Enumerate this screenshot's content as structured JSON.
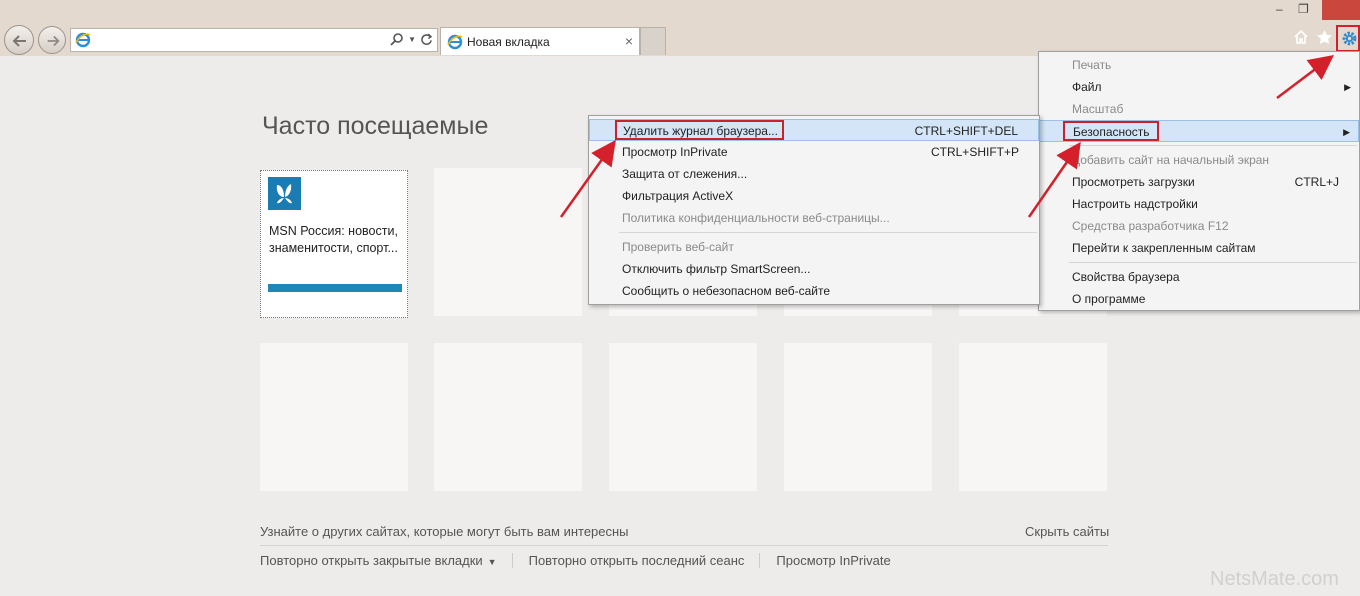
{
  "browser": {
    "tab_title": "Новая вкладка",
    "address_value": ""
  },
  "page": {
    "heading": "Часто посещаемые",
    "tiles": [
      {
        "title": "MSN Россия: новости, знаменитости, спорт..."
      }
    ],
    "suggest_link": "Узнайте о других сайтах, которые могут быть вам интересны",
    "hide_link": "Скрыть сайты",
    "bottom_links": [
      "Повторно открыть закрытые вкладки",
      "Повторно открыть последний сеанс",
      "Просмотр InPrivate"
    ],
    "watermark": "NetsMate.com"
  },
  "tools_menu": {
    "items": [
      {
        "label": "Печать",
        "disabled": true,
        "submenu": true
      },
      {
        "label": "Файл",
        "disabled": false,
        "submenu": true
      },
      {
        "label": "Масштаб",
        "disabled": true,
        "submenu": true
      },
      {
        "label": "Безопасность",
        "disabled": false,
        "submenu": true,
        "highlighted": true
      },
      {
        "label": "Добавить сайт на начальный экран",
        "disabled": true
      },
      {
        "label": "Просмотреть загрузки",
        "shortcut": "CTRL+J"
      },
      {
        "label": "Настроить надстройки"
      },
      {
        "label": "Средства разработчика F12",
        "disabled": true
      },
      {
        "label": "Перейти к закрепленным сайтам"
      },
      {
        "label": "Свойства браузера"
      },
      {
        "label": "О программе"
      }
    ]
  },
  "security_menu": {
    "items": [
      {
        "label": "Удалить журнал браузера...",
        "shortcut": "CTRL+SHIFT+DEL",
        "highlighted": true
      },
      {
        "label": "Просмотр InPrivate",
        "shortcut": "CTRL+SHIFT+P"
      },
      {
        "label": "Защита от слежения..."
      },
      {
        "label": "Фильтрация ActiveX"
      },
      {
        "label": "Политика конфиденциальности веб-страницы...",
        "disabled": true
      },
      {
        "label": "Проверить веб-сайт",
        "disabled": true
      },
      {
        "label": "Отключить фильтр SmartScreen..."
      },
      {
        "label": "Сообщить о небезопасном веб-сайте"
      }
    ]
  },
  "icons": {
    "back": "back-arrow-icon",
    "forward": "forward-arrow-icon",
    "ie": "internet-explorer-icon",
    "search": "search-icon",
    "refresh": "refresh-icon",
    "home": "home-icon",
    "favorites": "star-icon",
    "tools": "gear-icon"
  },
  "colors": {
    "annotation_red": "#d4202a",
    "menu_highlight": "#d3e5f7",
    "msn_blue": "#1b7cb4"
  }
}
